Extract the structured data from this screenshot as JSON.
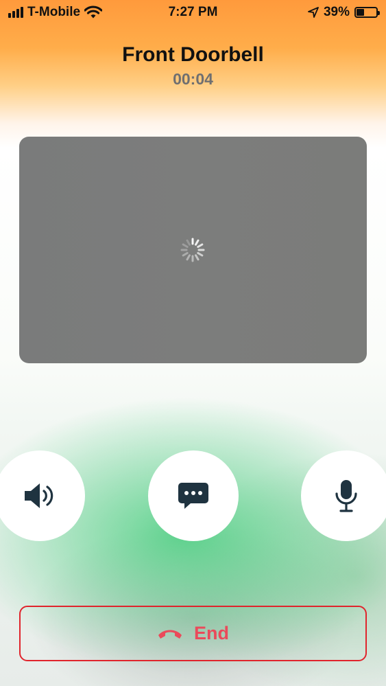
{
  "status_bar": {
    "carrier": "T-Mobile",
    "time": "7:27 PM",
    "battery_percent": "39%",
    "battery_level": 0.39,
    "icons": [
      "signal-icon",
      "wifi-icon",
      "location-arrow-icon",
      "battery-icon"
    ]
  },
  "call": {
    "title": "Front Doorbell",
    "duration": "00:04"
  },
  "video": {
    "state_icon": "loading-spinner-icon"
  },
  "controls": {
    "speaker_icon": "speaker-icon",
    "message_icon": "chat-bubble-icon",
    "mic_icon": "microphone-icon"
  },
  "end_button": {
    "label": "End",
    "icon": "phone-hangup-icon"
  },
  "colors": {
    "end_accent": "#ea4a5a",
    "end_border": "#e0242c",
    "icon_dark": "#1f3340",
    "timer_gray": "#6f6f70"
  }
}
